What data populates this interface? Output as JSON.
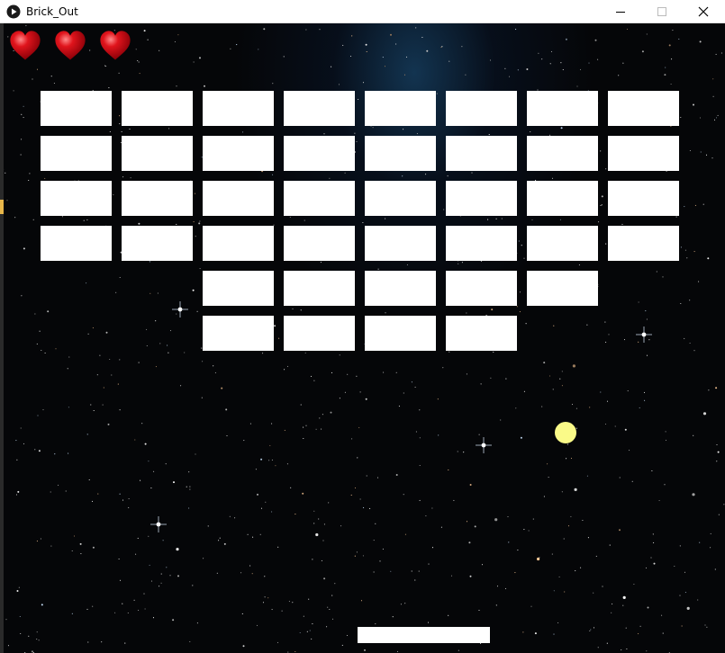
{
  "window": {
    "title": "Brick_Out",
    "controls": [
      "minimize",
      "maximize",
      "close"
    ]
  },
  "game": {
    "lives": 3,
    "heart_color": "#e0141c",
    "ball_color": "#fafa88",
    "brick_color": "#ffffff",
    "paddle_color": "#ffffff",
    "brick_rows": [
      [
        1,
        1,
        1,
        1,
        1,
        1,
        1,
        1
      ],
      [
        1,
        1,
        1,
        1,
        1,
        1,
        1,
        1
      ],
      [
        1,
        1,
        1,
        1,
        1,
        1,
        1,
        1
      ],
      [
        1,
        1,
        1,
        1,
        1,
        1,
        1,
        1
      ],
      [
        0,
        0,
        1,
        1,
        1,
        1,
        1,
        0
      ],
      [
        0,
        0,
        1,
        1,
        1,
        1,
        0,
        0
      ]
    ]
  }
}
